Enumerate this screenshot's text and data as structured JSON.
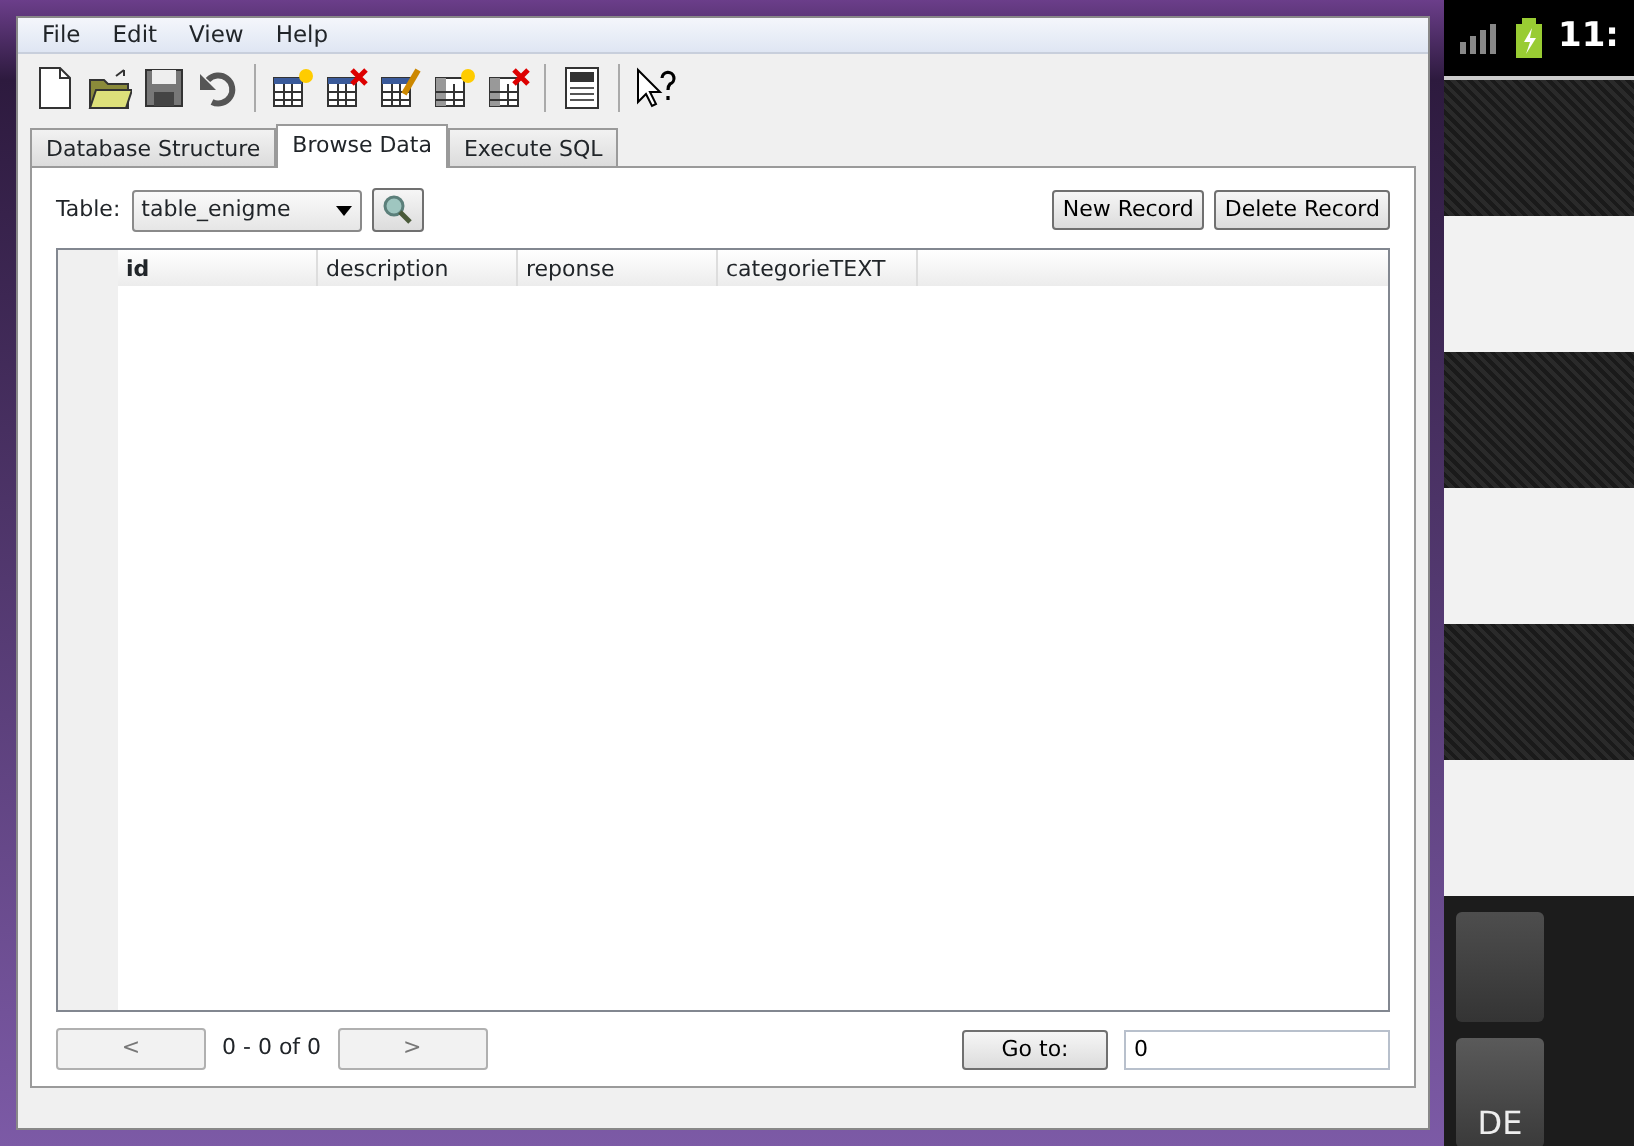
{
  "menu": [
    "File",
    "Edit",
    "View",
    "Help"
  ],
  "toolbar": [
    {
      "kind": "new"
    },
    {
      "kind": "open"
    },
    {
      "kind": "save"
    },
    {
      "kind": "undo"
    },
    {
      "kind": "sep"
    },
    {
      "kind": "table-new"
    },
    {
      "kind": "table-delete"
    },
    {
      "kind": "table-edit"
    },
    {
      "kind": "index-new"
    },
    {
      "kind": "index-delete"
    },
    {
      "kind": "sep"
    },
    {
      "kind": "log"
    },
    {
      "kind": "sep"
    },
    {
      "kind": "help"
    }
  ],
  "tabs": [
    {
      "label": "Database Structure",
      "selected": false
    },
    {
      "label": "Browse Data",
      "selected": true
    },
    {
      "label": "Execute SQL",
      "selected": false
    }
  ],
  "table_label": "Table:",
  "table_select": "table_enigme",
  "buttons": [
    "New Record",
    "Delete Record"
  ],
  "columns": [
    "id",
    "description",
    "reponse",
    "categorieTEXT"
  ],
  "pager": {
    "prev": "<",
    "info": "0 - 0 of 0",
    "next": ">",
    "goto": "Go to:",
    "goto_value": "0"
  },
  "phone": {
    "time": "11:",
    "key_label": "DE"
  }
}
